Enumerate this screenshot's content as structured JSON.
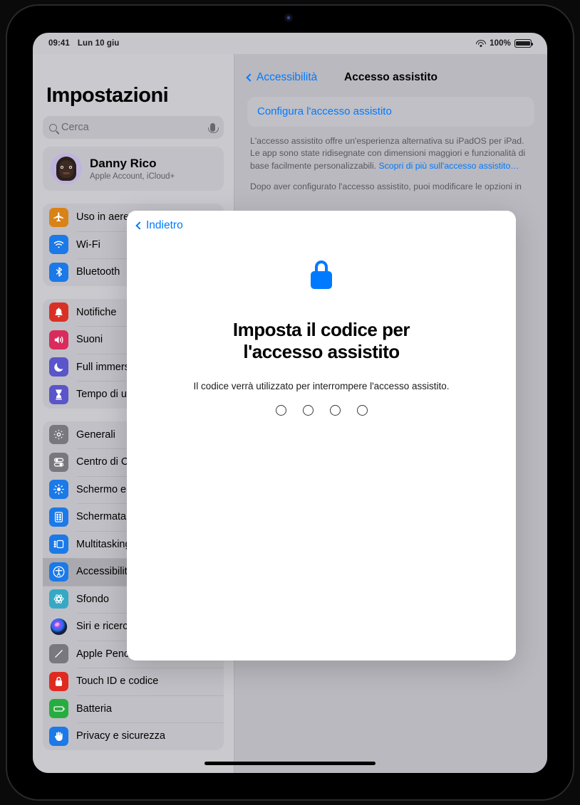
{
  "status_bar": {
    "time": "09:41",
    "date": "Lun 10 giu",
    "wifi_icon": "wifi-icon",
    "battery_percent": "100%",
    "battery_icon": "battery-icon"
  },
  "sidebar": {
    "title": "Impostazioni",
    "search": {
      "placeholder": "Cerca",
      "icon": "search-icon",
      "mic_icon": "microphone-icon"
    },
    "account": {
      "name": "Danny Rico",
      "subtitle": "Apple Account, iCloud+",
      "avatar": "memoji-avatar"
    },
    "groups": [
      {
        "items": [
          {
            "label": "Uso in aereo",
            "icon": "airplane-icon",
            "color": "#d98218",
            "selected": false
          },
          {
            "label": "Wi-Fi",
            "icon": "wifi-icon",
            "color": "#1b79e8",
            "selected": false
          },
          {
            "label": "Bluetooth",
            "icon": "bluetooth-icon",
            "color": "#1b79e8",
            "selected": false
          }
        ]
      },
      {
        "items": [
          {
            "label": "Notifiche",
            "icon": "bell-icon",
            "color": "#d93025",
            "selected": false
          },
          {
            "label": "Suoni",
            "icon": "speaker-icon",
            "color": "#d92b5c",
            "selected": false
          },
          {
            "label": "Full immersion",
            "icon": "moon-icon",
            "color": "#5a55c9",
            "selected": false
          },
          {
            "label": "Tempo di utilizzo",
            "icon": "hourglass-icon",
            "color": "#5a55c9",
            "selected": false
          }
        ]
      },
      {
        "items": [
          {
            "label": "Generali",
            "icon": "gear-icon",
            "color": "#78787e",
            "selected": false
          },
          {
            "label": "Centro di Controllo",
            "icon": "control-center-icon",
            "color": "#78787e",
            "selected": false
          },
          {
            "label": "Schermo e luminosità",
            "icon": "brightness-icon",
            "color": "#1b79e8",
            "selected": false
          },
          {
            "label": "Schermata Home e Libreria app",
            "icon": "home-screen-icon",
            "color": "#1b79e8",
            "selected": false
          },
          {
            "label": "Multitasking e gesti",
            "icon": "multitasking-icon",
            "color": "#1b79e8",
            "selected": false
          },
          {
            "label": "Accessibilità",
            "icon": "accessibility-icon",
            "color": "#1b79e8",
            "selected": true
          },
          {
            "label": "Sfondo",
            "icon": "wallpaper-icon",
            "color": "#37a8c4",
            "selected": false
          },
          {
            "label": "Siri e ricerca",
            "icon": "siri-icon",
            "color": "#1c1c1e",
            "selected": false
          },
          {
            "label": "Apple Pencil",
            "icon": "pencil-icon",
            "color": "#78787e",
            "selected": false
          },
          {
            "label": "Touch ID e codice",
            "icon": "lock-icon",
            "color": "#e02a20",
            "selected": false
          },
          {
            "label": "Batteria",
            "icon": "battery-icon",
            "color": "#27ad3f",
            "selected": false
          },
          {
            "label": "Privacy e sicurezza",
            "icon": "hand-icon",
            "color": "#1b79e8",
            "selected": false
          }
        ]
      }
    ]
  },
  "detail": {
    "back_label": "Accessibilità",
    "back_icon": "chevron-left-icon",
    "title": "Accesso assistito",
    "configure_label": "Configura l'accesso assistito",
    "paragraph_1": "L'accesso assistito offre un'esperienza alternativa su iPadOS per iPad. Le app sono state ridisegnate con dimensioni maggiori e funzionalità di base facilmente personalizzabili. ",
    "paragraph_1_link": "Scopri di più sull'accesso assistito…",
    "paragraph_2": "Dopo aver configurato l'accesso assistito, puoi modificare le opzioni in"
  },
  "modal": {
    "back_label": "Indietro",
    "back_icon": "chevron-left-icon",
    "lock_icon": "lock-icon",
    "title": "Imposta il codice per l'accesso assistito",
    "subtitle": "Il codice verrà utilizzato per interrompere l'accesso assistito.",
    "passcode": {
      "length": 4,
      "filled": 0
    }
  },
  "colors": {
    "accent_blue": "#007aff",
    "screen_background": "#c6c6cb",
    "sidebar_background": "#c9c9ce",
    "detail_background": "#b9b9bf",
    "modal_background": "#ffffff"
  },
  "home_indicator": "home-indicator"
}
